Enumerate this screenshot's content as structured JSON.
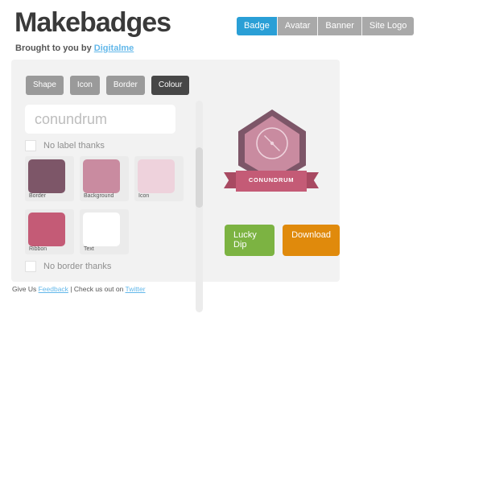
{
  "header": {
    "site_title": "Makebadges",
    "tagline_prefix": "Brought to you by ",
    "tagline_link": "Digitalme"
  },
  "topnav": {
    "items": [
      {
        "label": "Badge",
        "active": true
      },
      {
        "label": "Avatar",
        "active": false
      },
      {
        "label": "Banner",
        "active": false
      },
      {
        "label": "Site Logo",
        "active": false
      }
    ],
    "active_color": "#2a9fd6",
    "inactive_color": "#a9a9a9"
  },
  "editor": {
    "tabs": [
      {
        "label": "Shape",
        "active": false
      },
      {
        "label": "Icon",
        "active": false
      },
      {
        "label": "Border",
        "active": false
      },
      {
        "label": "Colour",
        "active": true
      }
    ],
    "label_input": {
      "value": "conundrum",
      "placeholder": "conundrum"
    },
    "checkboxes": [
      {
        "label": "No label thanks",
        "checked": false
      },
      {
        "label": "No border thanks",
        "checked": false
      }
    ],
    "swatches": [
      {
        "name": "Border",
        "color": "#7d5668"
      },
      {
        "name": "Background",
        "color": "#c98ba0"
      },
      {
        "name": "Icon",
        "color": "#eed2dc"
      },
      {
        "name": "Ribbon",
        "color": "#c45b76"
      },
      {
        "name": "Text",
        "color": "#ffffff"
      }
    ],
    "scrollbar": {
      "track_color": "#ececec",
      "thumb_color": "#d8d8d8"
    }
  },
  "preview": {
    "badge": {
      "ribbon_text": "CONUNDRUM",
      "border_color": "#7d5668",
      "background_color": "#c98ba0",
      "icon_color": "#eed2dc",
      "ribbon_color": "#c45b76",
      "ribbon_tail_color": "#a84a62",
      "text_color": "#ffffff",
      "icon_name": "compass-icon"
    },
    "buttons": [
      {
        "label": "Lucky Dip",
        "color": "#7cb342"
      },
      {
        "label": "Download",
        "color": "#e08a0c"
      }
    ]
  },
  "footer": {
    "give_us": "Give Us ",
    "feedback_link": "Feedback",
    "separator": " | Check us out on ",
    "twitter_link": "Twitter"
  }
}
